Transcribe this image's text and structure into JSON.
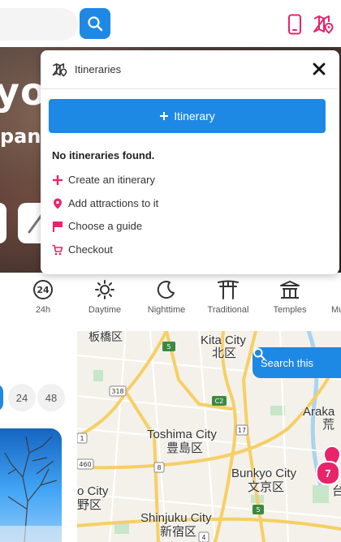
{
  "topbar": {
    "search_icon": "search-icon",
    "phone_icon": "phone-icon",
    "itinerary_map_icon": "map-pin-icon"
  },
  "hero": {
    "title_partial": "yo",
    "subtitle_partial": "pan"
  },
  "categories": [
    {
      "label": "24h",
      "icon": "24h-icon"
    },
    {
      "label": "Daytime",
      "icon": "sun-icon"
    },
    {
      "label": "Nighttime",
      "icon": "moon-icon"
    },
    {
      "label": "Traditional",
      "icon": "torii-icon"
    },
    {
      "label": "Temples",
      "icon": "temple-icon"
    },
    {
      "label": "Mu",
      "icon": "museum-icon"
    }
  ],
  "filters": {
    "chips": [
      "24",
      "48"
    ]
  },
  "map": {
    "search_label": "Search this",
    "cluster_count": "7",
    "labels": [
      {
        "text": "板橋区"
      },
      {
        "text": "Kita City"
      },
      {
        "text": "北区"
      },
      {
        "text": "Araka"
      },
      {
        "text": "荒"
      },
      {
        "text": "Toshima City"
      },
      {
        "text": "豊島区"
      },
      {
        "text": "Bunkyo City"
      },
      {
        "text": "文京区"
      },
      {
        "text": "o City"
      },
      {
        "text": "野区"
      },
      {
        "text": "Shinjuku City"
      },
      {
        "text": "新宿区"
      },
      {
        "text": "台"
      }
    ],
    "route_shields": [
      "5",
      "318",
      "C2",
      "17",
      "8",
      "5",
      "4",
      "460",
      "1"
    ]
  },
  "popup": {
    "title": "Itineraries",
    "add_button": "Itinerary",
    "empty_message": "No itineraries found.",
    "steps": [
      {
        "label": "Create an itinerary",
        "icon": "plus-icon"
      },
      {
        "label": "Add attractions to it",
        "icon": "location-pin-icon"
      },
      {
        "label": "Choose a guide",
        "icon": "flag-icon"
      },
      {
        "label": "Checkout",
        "icon": "cart-icon"
      }
    ]
  },
  "colors": {
    "accent": "#1e88e5",
    "brand_pink": "#e8246a"
  }
}
